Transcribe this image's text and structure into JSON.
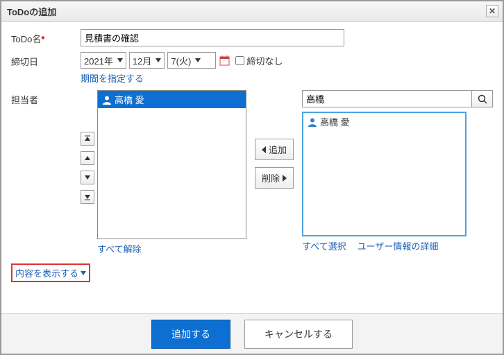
{
  "dialog": {
    "title": "ToDoの追加"
  },
  "labels": {
    "todo_name": "ToDo名",
    "deadline": "締切日",
    "assignee": "担当者",
    "no_deadline": "締切なし",
    "period_link": "期間を指定する",
    "deselect_all": "すべて解除",
    "select_all": "すべて選択",
    "user_details": "ユーザー情報の詳細",
    "show_content": "内容を表示する",
    "add_btn": "追加",
    "remove_btn": "削除",
    "submit": "追加する",
    "cancel": "キャンセルする"
  },
  "fields": {
    "todo_name_value": "見積書の確認",
    "year": "2021年",
    "month": "12月",
    "day": "7(火)",
    "search_value": "高橋"
  },
  "selected_members": [
    {
      "name": "高橋 愛"
    }
  ],
  "candidate_members": [
    {
      "name": "高橋 愛"
    }
  ]
}
